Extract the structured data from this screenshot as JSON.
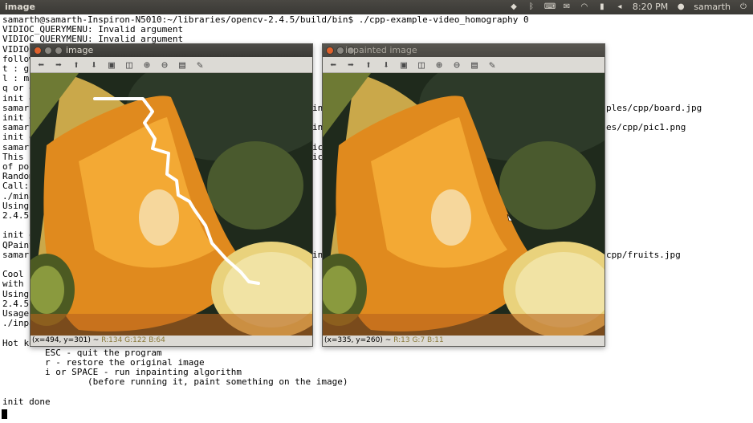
{
  "topbar": {
    "title": "image",
    "time": "8:20 PM",
    "user": "samarth"
  },
  "terminal": {
    "lines": [
      "samarth@samarth-Inspiron-N5010:~/libraries/opencv-2.4.5/build/bin$ ./cpp-example-video_homography 0",
      "VIDIOC_QUERYMENU: Invalid argument",
      "VIDIOC_QUERYMENU: Invalid argument",
      "VIDIOC_",
      "follow",
      "t : gr",
      "l : ma",
      "q or e",
      "init d",
      "samarth",
      "init d",
      "samart",
      "init d",
      "samart",
      "This p",
      "of poi",
      "Random",
      "Call:",
      "./mina",
      "Using",
      "2.4.5",
      "",
      "init d",
      "QPaint",
      "samart",
      "",
      "Cool i",
      "with s",
      "Using",
      "2.4.5",
      "Usage:",
      "./inpa",
      "",
      "Hot ke",
      "        ESC - quit the program",
      "        r - restore the original image",
      "        i or SPACE - run inpainting algorithm",
      "                (before running it, paint something on the image)",
      "",
      "init done"
    ],
    "right_fragments": [
      {
        "row": 9,
        "text": "ples/cpp/board.jpg"
      },
      {
        "row": 11,
        "text": "es/cpp/pic1.png"
      },
      {
        "row": 24,
        "text": "cpp/fruits.jpg"
      }
    ],
    "mid_fragments": [
      {
        "row": 9,
        "text": "in"
      },
      {
        "row": 11,
        "text": "in"
      },
      {
        "row": 13,
        "text": "ic"
      },
      {
        "row": 14,
        "text": "ic"
      },
      {
        "row": 24,
        "text": "in"
      }
    ]
  },
  "windows": {
    "image": {
      "title": "image",
      "status_coords": "(x=494, y=301) ~",
      "status_rgb": "R:134 G:122 B:64"
    },
    "inpainted": {
      "title": "inpainted image",
      "status_coords": "(x=335, y=260) ~",
      "status_rgb": "R:13 G:7 B:11"
    }
  },
  "toolbar_icons": [
    "arrow-left-icon",
    "arrow-right-icon",
    "arrow-up-icon",
    "arrow-down-icon",
    "save-image-icon",
    "zoom-fit-icon",
    "zoom-in-icon",
    "zoom-out-icon",
    "save-disk-icon",
    "properties-brush-icon"
  ],
  "colors": {
    "panel_bg": "#dcdad5",
    "titlebar": "#3c3b37",
    "terminal_bg": "#ffffff",
    "close_button": "#e0612c",
    "mask_stroke": "#ffffff"
  }
}
